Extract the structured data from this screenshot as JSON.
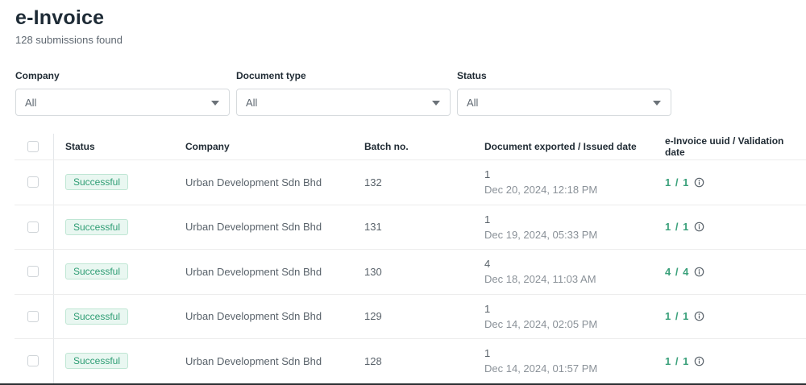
{
  "header": {
    "title": "e-Invoice",
    "subtitle": "128 submissions found"
  },
  "filters": [
    {
      "label": "Company",
      "value": "All"
    },
    {
      "label": "Document type",
      "value": "All"
    },
    {
      "label": "Status",
      "value": "All"
    }
  ],
  "table": {
    "columns": {
      "status": "Status",
      "company": "Company",
      "batch": "Batch no.",
      "document": "Document exported / Issued date",
      "uuid": "e-Invoice uuid / Validation date"
    },
    "rows": [
      {
        "status": "Successful",
        "company": "Urban Development Sdn Bhd",
        "batch": "132",
        "doc_count": "1",
        "date": "Dec 20, 2024, 12:18 PM",
        "uuid": "1 / 1"
      },
      {
        "status": "Successful",
        "company": "Urban Development Sdn Bhd",
        "batch": "131",
        "doc_count": "1",
        "date": "Dec 19, 2024, 05:33 PM",
        "uuid": "1 / 1"
      },
      {
        "status": "Successful",
        "company": "Urban Development Sdn Bhd",
        "batch": "130",
        "doc_count": "4",
        "date": "Dec 18, 2024, 11:03 AM",
        "uuid": "4 / 4"
      },
      {
        "status": "Successful",
        "company": "Urban Development Sdn Bhd",
        "batch": "129",
        "doc_count": "1",
        "date": "Dec 14, 2024, 02:05 PM",
        "uuid": "1 / 1"
      },
      {
        "status": "Successful",
        "company": "Urban Development Sdn Bhd",
        "batch": "128",
        "doc_count": "1",
        "date": "Dec 14, 2024, 01:57 PM",
        "uuid": "1 / 1"
      }
    ]
  },
  "colors": {
    "accent": "#3ba17b",
    "badge_bg": "#e9f7f1",
    "badge_border": "#bfe6d4"
  },
  "icons": {
    "filter_caret": "caret-down-icon",
    "uuid_info": "info-icon"
  }
}
